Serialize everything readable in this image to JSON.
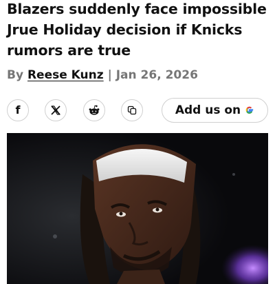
{
  "article": {
    "headline": "Blazers suddenly face impossible Jrue Holiday decision if Knicks rumors are true",
    "byline": {
      "prefix": "By",
      "author": "Reese Kunz",
      "separator": "|",
      "date": "Jan 26, 2026"
    }
  },
  "share": {
    "buttons": [
      {
        "icon": "facebook-icon",
        "label": "f"
      },
      {
        "icon": "x-icon",
        "label": "𝕏"
      },
      {
        "icon": "reddit-icon"
      },
      {
        "icon": "copy-link-icon"
      }
    ],
    "add_us": {
      "label": "Add us on",
      "icon": "google-icon"
    }
  },
  "hero_image": {
    "subject": "basketball-player-headband"
  },
  "colors": {
    "text": "#111111",
    "muted": "#767676",
    "border": "#cfcfcf",
    "google_blue": "#4285F4",
    "google_red": "#EA4335",
    "google_yellow": "#FBBC05",
    "google_green": "#34A853"
  }
}
